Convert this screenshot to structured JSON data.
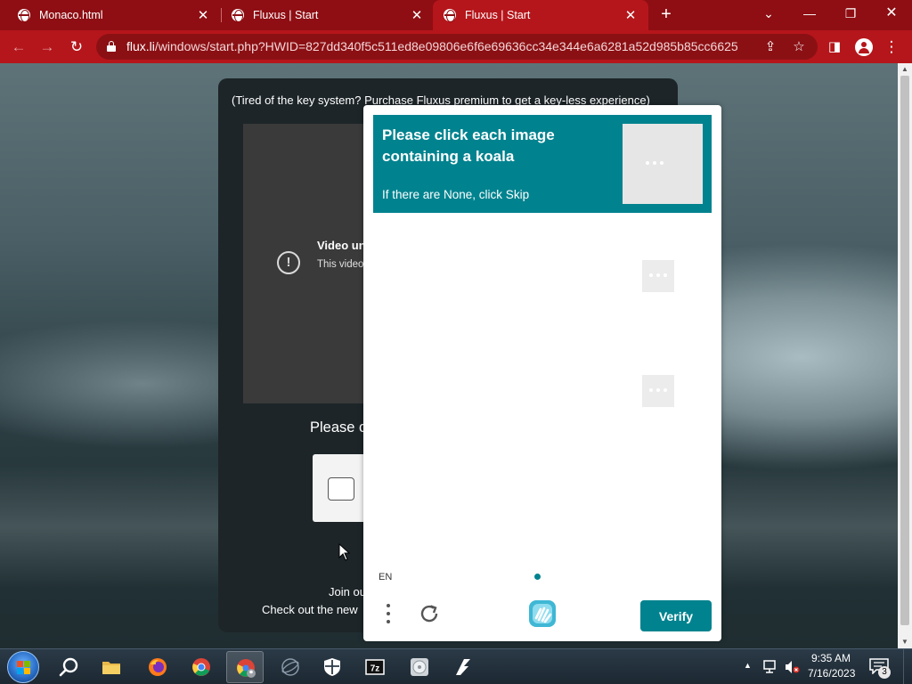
{
  "browser": {
    "tabs": [
      {
        "title": "Monaco.html",
        "active": false
      },
      {
        "title": "Fluxus | Start",
        "active": false
      },
      {
        "title": "Fluxus | Start",
        "active": true
      }
    ],
    "new_tab_label": "+",
    "address": {
      "host": "flux.li",
      "path": "/windows/start.php?HWID=827dd340f5c511ed8e09806e6f6e69636cc34e344e6a6281a52d985b85cc6625"
    },
    "accent_color": "#b5161b"
  },
  "page": {
    "banner": "(Tired of the key system? Purchase Fluxus premium to get a key-less experience)",
    "video": {
      "title": "Video un",
      "subtitle": "This video associate"
    },
    "please_text": "Please c",
    "join_text": "Join ou",
    "checkout_text": "Check out the new"
  },
  "captcha": {
    "prompt": "Please click each image containing a koala",
    "subprompt": "If there are None, click Skip",
    "language": "EN",
    "verify_label": "Verify",
    "accent_color": "#00838f"
  },
  "taskbar": {
    "time": "9:35 AM",
    "date": "7/16/2023",
    "notification_count": "3",
    "pinned": [
      "file-explorer",
      "firefox",
      "chrome",
      "chrome-profile",
      "app-sphere",
      "security-shield",
      "7zip",
      "disc-app",
      "fluxus"
    ]
  }
}
